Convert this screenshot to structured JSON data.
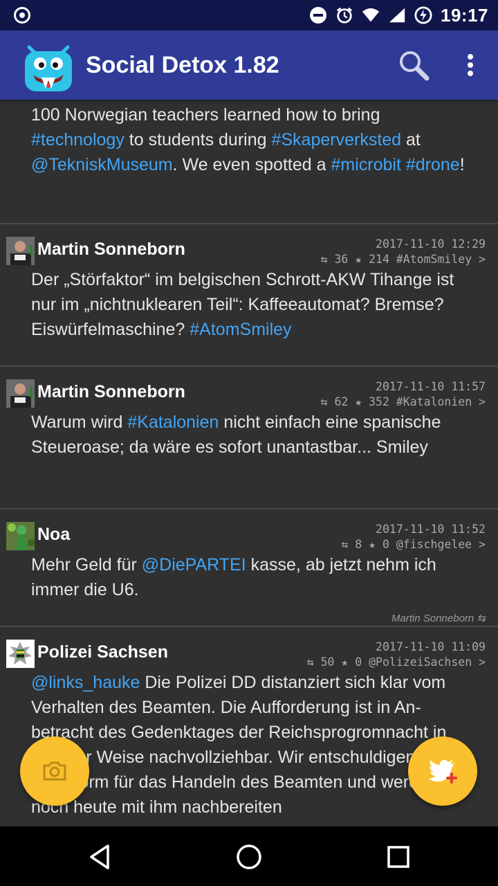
{
  "status_bar": {
    "time": "19:17"
  },
  "app_bar": {
    "title": "Social Detox 1.82"
  },
  "feed": {
    "first_tweet_text": [
      {
        "t": "100 Norwegian teachers learned how to bring ",
        "link": false
      },
      {
        "t": "#technology",
        "link": true
      },
      {
        "t": " to students during ",
        "link": false
      },
      {
        "t": "#Skaperverksted",
        "link": true
      },
      {
        "t": " at ",
        "link": false
      },
      {
        "t": "@TekniskMuseum",
        "link": true
      },
      {
        "t": ". We even spotted a ",
        "link": false
      },
      {
        "t": "#microbit",
        "link": true
      },
      {
        "t": " ",
        "link": false
      },
      {
        "t": "#drone",
        "link": true
      },
      {
        "t": "!",
        "link": false
      }
    ],
    "tweets": [
      {
        "author": "Martin Sonneborn",
        "timestamp": "2017-11-10 12:29",
        "stats": "⇆ 36 ★ 214 #AtomSmiley >",
        "text": [
          {
            "t": "Der „Störfaktor“ im belgischen Schrott-AKW Tihange ist nur im „nichtnuklearen Teil“: Kaffeeautomat? Bremse? Eiswürfelmaschine? ",
            "link": false
          },
          {
            "t": "#AtomSmiley",
            "link": true
          }
        ]
      },
      {
        "author": "Martin Sonneborn",
        "timestamp": "2017-11-10 11:57",
        "stats": "⇆ 62 ★ 352 #Katalonien >",
        "text": [
          {
            "t": "Warum wird ",
            "link": false
          },
          {
            "t": "#Katalonien",
            "link": true
          },
          {
            "t": " nicht einfach eine spanische Steueroase; da wäre es sofort unantastbar... Smiley",
            "link": false
          }
        ]
      },
      {
        "author": "Noa",
        "timestamp": "2017-11-10 11:52",
        "stats": "⇆ 8 ★ 0 @fischgelee >",
        "text": [
          {
            "t": "Mehr Geld für ",
            "link": false
          },
          {
            "t": "@DiePARTEI",
            "link": true
          },
          {
            "t": " kasse, ab jetzt nehm ich immer die U6.",
            "link": false
          }
        ],
        "retweeted_by": "Martin Sonneborn ⇆"
      },
      {
        "author": "Polizei Sachsen",
        "timestamp": "2017-11-10 11:09",
        "stats": "⇆ 50 ★ 0 @PolizeiSachsen >",
        "text": [
          {
            "t": "@links_hauke",
            "link": true
          },
          {
            "t": " Die Polizei DD distanziert sich klar vom Verhalten des Beamten. Die Aufforderung ist in An­betracht des Gedenktages der Reichsprogromnacht in keinster Weise nachvollziehbar. Wir entschuldigen uns in aller Form für das Handeln des Beamten und werden es noch heute mit ihm nachbereiten",
            "link": false
          }
        ]
      }
    ]
  },
  "icons": {
    "camera": "camera-icon",
    "compose": "twitter-bird-add-icon",
    "search": "search-icon",
    "more": "more-vert-icon"
  },
  "colors": {
    "status_bar": "#10154a",
    "app_bar": "#2f3b97",
    "background": "#303030",
    "link": "#42a5f5",
    "fab": "#fbc02d"
  }
}
